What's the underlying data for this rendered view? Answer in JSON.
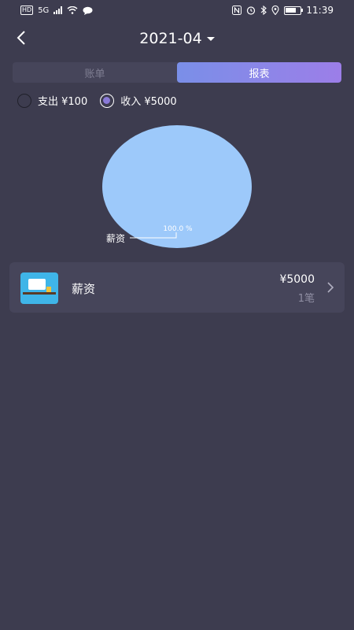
{
  "status_bar": {
    "left_badges": [
      "HD",
      "5G"
    ],
    "time": "11:39",
    "icons": [
      "nfc-icon",
      "alarm-icon",
      "bluetooth-icon",
      "location-icon",
      "battery-icon"
    ]
  },
  "header": {
    "month": "2021-04",
    "back_icon": "chevron-left-icon",
    "dropdown_icon": "caret-down-icon"
  },
  "tabs": [
    {
      "label": "账单",
      "active": false
    },
    {
      "label": "报表",
      "active": true
    }
  ],
  "radios": [
    {
      "label": "支出 ¥100",
      "selected": false
    },
    {
      "label": "收入 ¥5000",
      "selected": true
    }
  ],
  "chart_data": {
    "type": "pie",
    "slices": [
      {
        "label": "薪资",
        "value": 100.0,
        "percent_label": "100.0 %",
        "color": "#9dc9fa"
      }
    ]
  },
  "list": [
    {
      "name": "薪资",
      "amount": "¥5000",
      "count": "1笔",
      "icon": "salary-category-icon"
    }
  ],
  "colors": {
    "background": "#3d3c4f",
    "card": "#46455a",
    "accent_start": "#7a8fe8",
    "accent_end": "#9c7ee8",
    "pie": "#9dc9fa"
  }
}
